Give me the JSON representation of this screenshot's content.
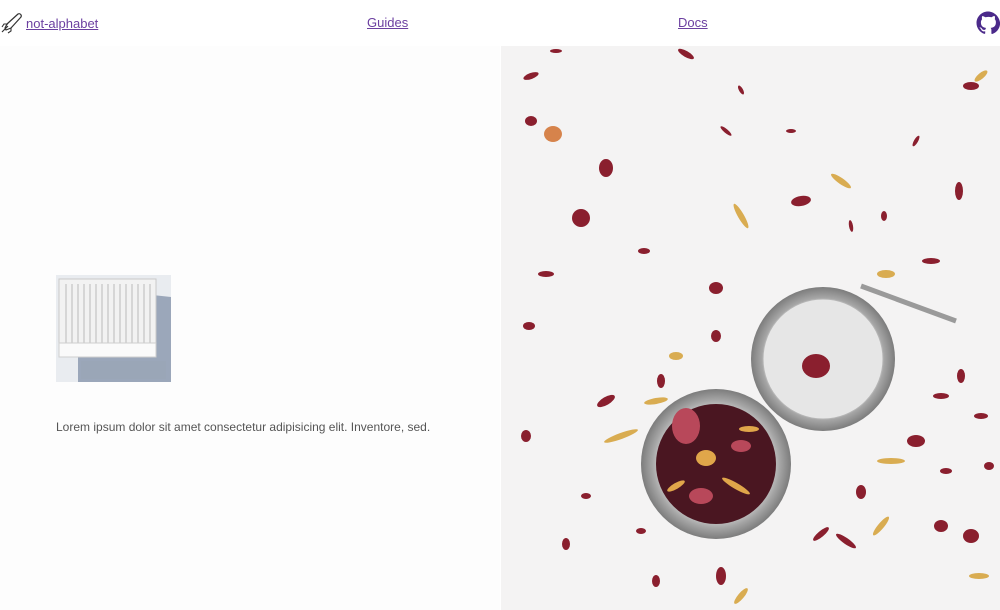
{
  "nav": {
    "brand_label": " not-alphabet",
    "links": [
      "Guides",
      "Docs"
    ]
  },
  "content": {
    "description": "Lorem ipsum dolor sit amet consectetur adipisicing elit. Inventore, sed."
  },
  "colors": {
    "link": "#6b3fa0",
    "github": "#4b2a8a"
  },
  "icons": {
    "brand": "rocket-icon",
    "github": "github-icon"
  }
}
